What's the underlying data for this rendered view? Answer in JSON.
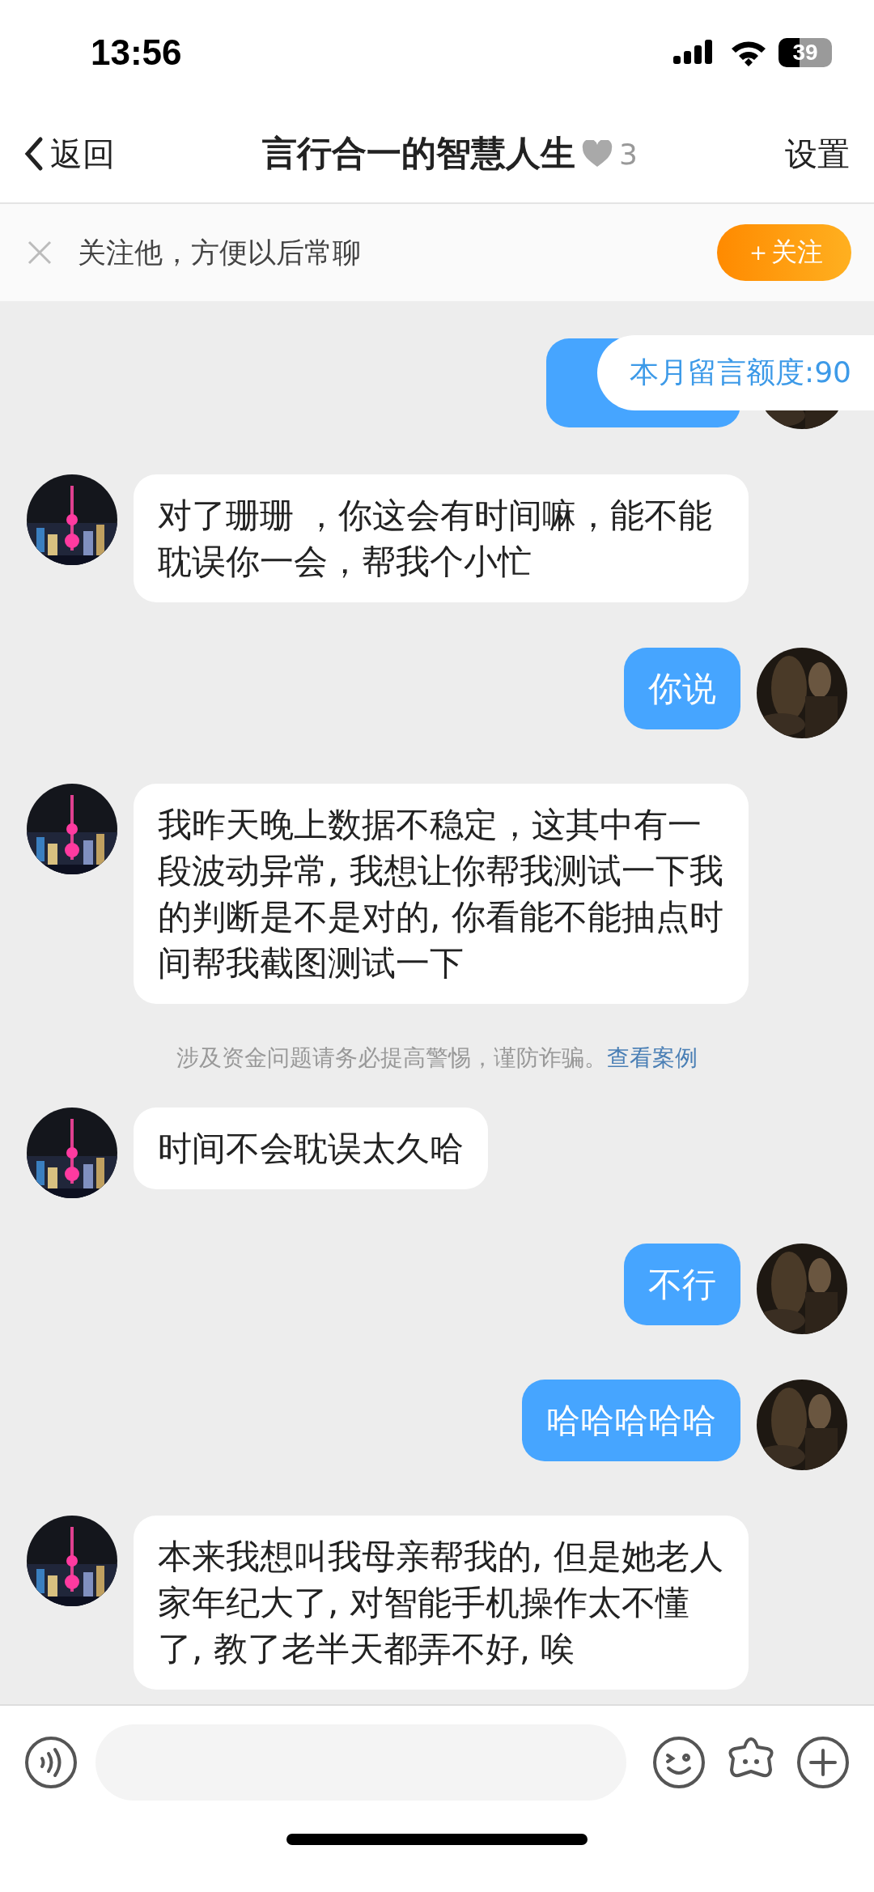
{
  "status_bar": {
    "time": "13:56",
    "battery": "39"
  },
  "header": {
    "back": "返回",
    "title": "言行合一的智慧人生",
    "intimacy": "3",
    "settings": "设置"
  },
  "follow_banner": {
    "text": "关注他，方便以后常聊",
    "button": "＋关注"
  },
  "quota_tooltip": "本月留言额度:90",
  "messages": [
    {
      "kind": "outgoing"
    },
    {
      "kind": "incoming",
      "text": "对了珊珊 ，你这会有时间嘛，能不能耽误你一会，帮我个小忙"
    },
    {
      "kind": "outgoing",
      "text": "你说"
    },
    {
      "kind": "incoming",
      "text": "我昨天晚上数据不稳定，这其中有一段波动异常, 我想让你帮我测试一下我的判断是不是对的, 你看能不能抽点时间帮我截图测试一下"
    },
    {
      "kind": "notice",
      "text": "涉及资金问题请务必提高警惕，谨防诈骗。",
      "link": "查看案例"
    },
    {
      "kind": "incoming",
      "text": " 时间不会耽误太久哈"
    },
    {
      "kind": "outgoing",
      "text": "不行"
    },
    {
      "kind": "outgoing",
      "text": "哈哈哈哈哈"
    },
    {
      "kind": "incoming",
      "text": "本来我想叫我母亲帮我的, 但是她老人家年纪大了, 对智能手机操作太不懂了, 教了老半天都弄不好, 唉"
    }
  ]
}
